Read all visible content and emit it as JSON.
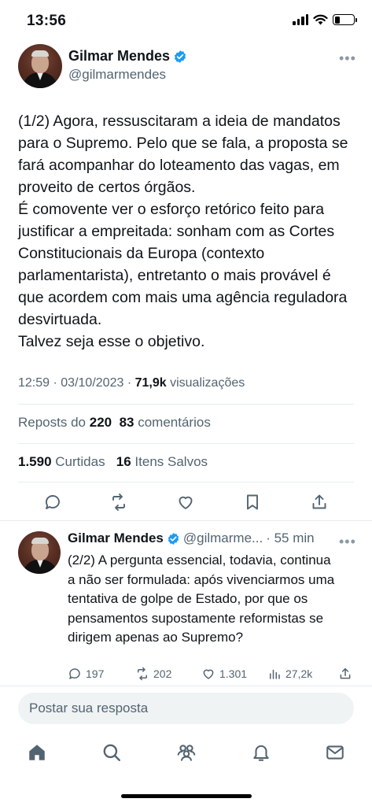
{
  "status_bar": {
    "time": "13:56",
    "battery_level": 0.3
  },
  "tweet": {
    "author_name": "Gilmar Mendes",
    "author_handle": "@gilmarmendes",
    "verified_color": "#1d9bf0",
    "text": "(1/2) Agora, ressuscitaram a ideia de mandatos para o Supremo. Pelo que se fala, a proposta se fará acompanhar do loteamento das vagas, em proveito de certos órgãos.\nÉ comovente ver o esforço retórico feito para justificar a empreitada: sonham com as Cortes Constitucionais da Europa (contexto parlamentarista), entretanto o mais provável é que acordem com mais uma agência reguladora desvirtuada.\nTalvez seja esse o objetivo.",
    "time": "12:59",
    "date": "03/10/2023",
    "views_count": "71,9k",
    "views_label": "visualizações",
    "reposts_label": "Reposts do",
    "reposts_count": "220",
    "comments_count": "83",
    "comments_label": "comentários",
    "likes_count": "1.590",
    "likes_label": "Curtidas",
    "saves_count": "16",
    "saves_label": "Itens Salvos",
    "more_label": "•••"
  },
  "reply": {
    "author_name": "Gilmar Mendes",
    "author_handle": "@gilmarme...",
    "age": "· 55 min",
    "text": "(2/2) A pergunta essencial, todavia, continua a não ser formulada: após vivenciarmos uma tentativa de golpe de Estado, por que os pensamentos supostamente reformistas se dirigem apenas ao Supremo?",
    "replies": "197",
    "reposts": "202",
    "likes": "1.301",
    "views": "27,2k",
    "more_label": "•••"
  },
  "composer": {
    "placeholder": "Postar sua resposta"
  },
  "tabbar": {
    "items": [
      "home-icon",
      "search-icon",
      "communities-icon",
      "notifications-icon",
      "messages-icon"
    ]
  }
}
